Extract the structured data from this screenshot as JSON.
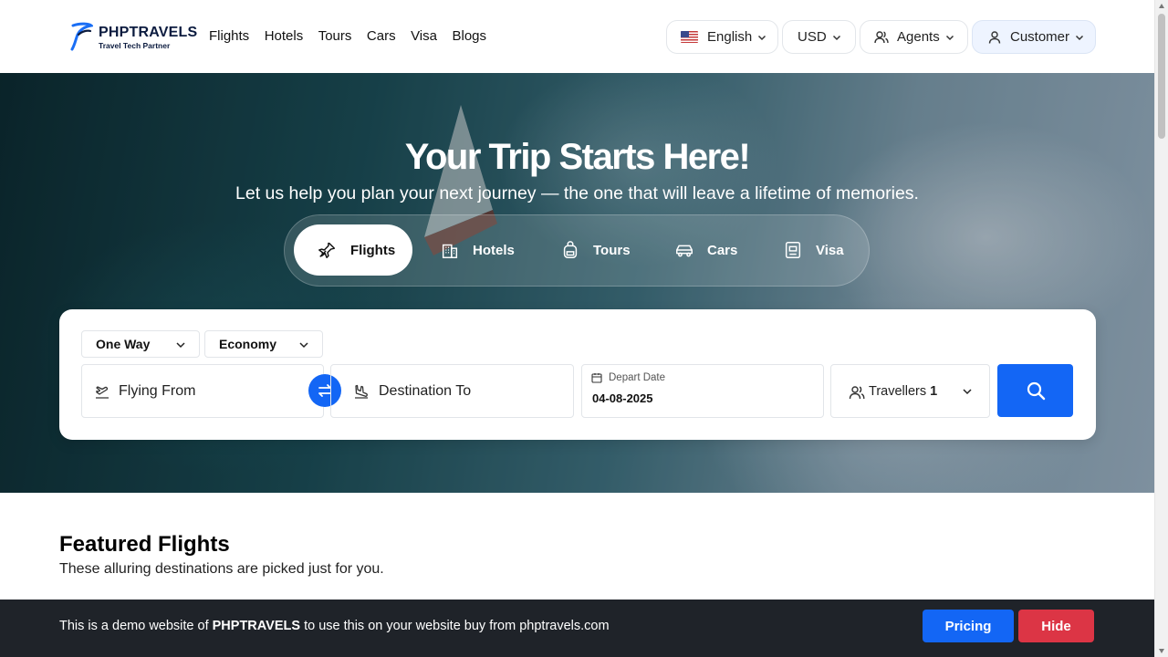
{
  "header": {
    "logo_name": "PHPTRAVELS",
    "logo_tagline": "Travel Tech Partner",
    "nav": [
      "Flights",
      "Hotels",
      "Tours",
      "Cars",
      "Visa",
      "Blogs"
    ],
    "language": "English",
    "currency": "USD",
    "agents": "Agents",
    "customer": "Customer"
  },
  "hero": {
    "title": "Your Trip Starts Here!",
    "subtitle": "Let us help you plan your next journey — the one that will leave a lifetime of memories.",
    "tabs": [
      {
        "label": "Flights",
        "icon": "plane-icon",
        "active": true
      },
      {
        "label": "Hotels",
        "icon": "building-icon",
        "active": false
      },
      {
        "label": "Tours",
        "icon": "backpack-icon",
        "active": false
      },
      {
        "label": "Cars",
        "icon": "car-icon",
        "active": false
      },
      {
        "label": "Visa",
        "icon": "passport-icon",
        "active": false
      }
    ]
  },
  "search": {
    "trip_type": "One Way",
    "cabin_class": "Economy",
    "from_placeholder": "Flying From",
    "to_placeholder": "Destination To",
    "depart_label": "Depart Date",
    "depart_value": "04-08-2025",
    "travellers_label": "Travellers",
    "travellers_count": "1"
  },
  "featured": {
    "title": "Featured Flights",
    "subtitle": "These alluring destinations are picked just for you."
  },
  "demo_bar": {
    "prefix": "This is a demo website of ",
    "brand": "PHPTRAVELS",
    "suffix": " to use this on your website buy from phptravels.com",
    "pricing": "Pricing",
    "hide": "Hide"
  },
  "colors": {
    "primary": "#1366f5",
    "danger": "#dc3545",
    "demo_bar_bg": "#1f2329",
    "customer_bg": "#eef4ff"
  }
}
